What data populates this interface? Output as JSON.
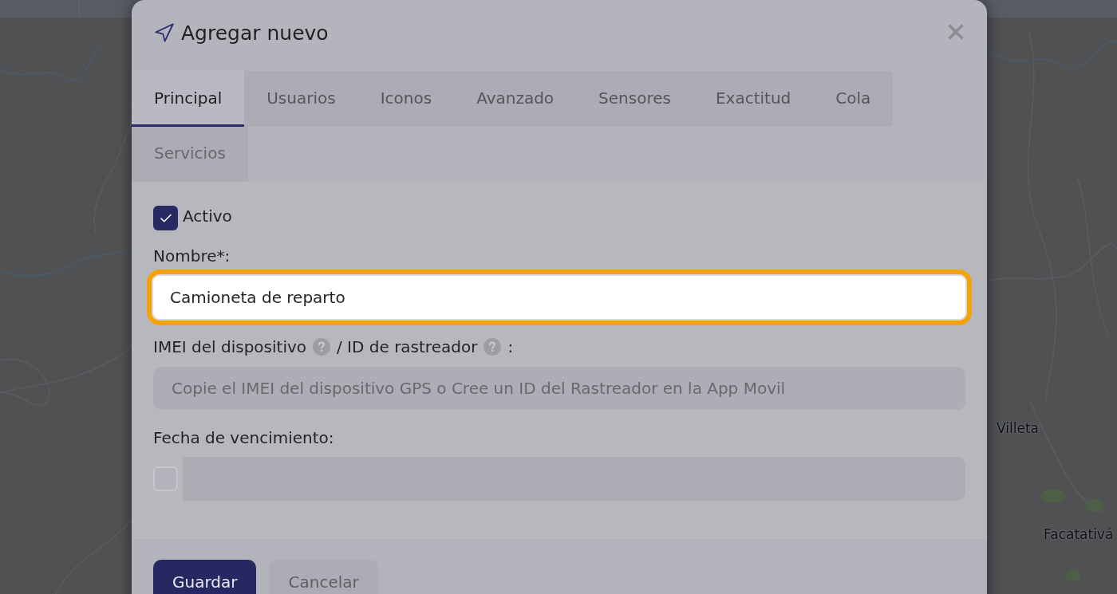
{
  "map": {
    "labels": [
      "Villeta",
      "Facatativá"
    ]
  },
  "dialog": {
    "title": "Agregar nuevo",
    "tabs": [
      {
        "label": "Principal",
        "selected": true,
        "disabled": false
      },
      {
        "label": "Usuarios",
        "selected": false,
        "disabled": false
      },
      {
        "label": "Iconos",
        "selected": false,
        "disabled": false
      },
      {
        "label": "Avanzado",
        "selected": false,
        "disabled": false
      },
      {
        "label": "Sensores",
        "selected": false,
        "disabled": false
      },
      {
        "label": "Exactitud",
        "selected": false,
        "disabled": false
      },
      {
        "label": "Cola",
        "selected": false,
        "disabled": false
      },
      {
        "label": "Servicios",
        "selected": false,
        "disabled": true
      }
    ],
    "fields": [
      {
        "kind": "checkbox",
        "label": "Activo",
        "checked": true
      },
      {
        "kind": "text",
        "label": "Nombre*:",
        "value": "Camioneta de reparto",
        "focused": true,
        "disabled": false
      },
      {
        "kind": "text",
        "label_parts": [
          {
            "text": "IMEI del dispositivo",
            "help": true
          },
          {
            "text": "/ ID de rastreador",
            "help": true
          },
          {
            "text": ":",
            "help": false
          }
        ],
        "placeholder": "Copie el IMEI del dispositivo GPS o Cree un ID del Rastreador en la App Movil",
        "focused": false,
        "disabled": true
      },
      {
        "kind": "date",
        "label": "Fecha de vencimiento:",
        "enabled": false
      }
    ],
    "buttons": [
      {
        "label": "Guardar",
        "kind": "primary"
      },
      {
        "label": "Cancelar",
        "kind": "secondary"
      }
    ]
  }
}
